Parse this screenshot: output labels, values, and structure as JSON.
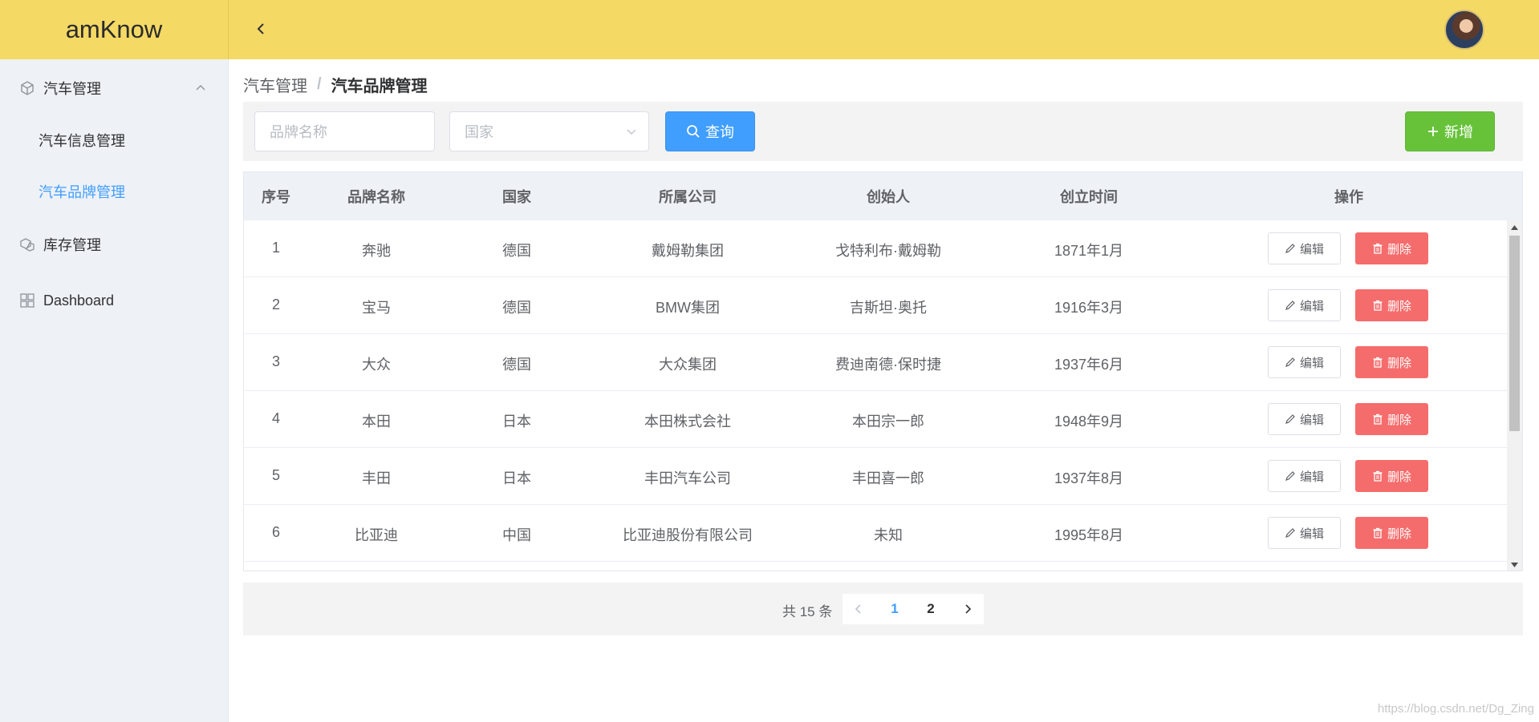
{
  "app": {
    "logo": "amKnow"
  },
  "sidebar": {
    "groups": [
      {
        "label": "汽车管理",
        "icon": "cube-icon",
        "expanded": true,
        "children": [
          {
            "label": "汽车信息管理",
            "active": false
          },
          {
            "label": "汽车品牌管理",
            "active": true
          }
        ]
      },
      {
        "label": "库存管理",
        "icon": "boxes-icon"
      },
      {
        "label": "Dashboard",
        "icon": "grid-icon"
      }
    ]
  },
  "breadcrumb": {
    "parent": "汽车管理",
    "separator": "/",
    "current": "汽车品牌管理"
  },
  "search": {
    "brand_placeholder": "品牌名称",
    "country_placeholder": "国家",
    "query_label": "查询",
    "add_label": "新增"
  },
  "table": {
    "columns": [
      "序号",
      "品牌名称",
      "国家",
      "所属公司",
      "创始人",
      "创立时间",
      "操作"
    ],
    "rows": [
      {
        "no": "1",
        "brand": "奔驰",
        "country": "德国",
        "company": "戴姆勒集团",
        "founder": "戈特利布·戴姆勒",
        "founded": "1871年1月"
      },
      {
        "no": "2",
        "brand": "宝马",
        "country": "德国",
        "company": "BMW集团",
        "founder": "吉斯坦·奥托",
        "founded": "1916年3月"
      },
      {
        "no": "3",
        "brand": "大众",
        "country": "德国",
        "company": "大众集团",
        "founder": "费迪南德·保时捷",
        "founded": "1937年6月"
      },
      {
        "no": "4",
        "brand": "本田",
        "country": "日本",
        "company": "本田株式会社",
        "founder": "本田宗一郎",
        "founded": "1948年9月"
      },
      {
        "no": "5",
        "brand": "丰田",
        "country": "日本",
        "company": "丰田汽车公司",
        "founder": "丰田喜一郎",
        "founded": "1937年8月"
      },
      {
        "no": "6",
        "brand": "比亚迪",
        "country": "中国",
        "company": "比亚迪股份有限公司",
        "founder": "未知",
        "founded": "1995年8月"
      }
    ],
    "edit_label": "编辑",
    "delete_label": "删除"
  },
  "pagination": {
    "total_text": "共 15 条",
    "pages": [
      "1",
      "2"
    ],
    "current": "1"
  },
  "watermark": "https://blog.csdn.net/Dg_Zing",
  "colors": {
    "header": "#f5d965",
    "sidebar": "#eef1f6",
    "primary": "#409eff",
    "success": "#67c23a",
    "danger": "#f56c6c"
  }
}
